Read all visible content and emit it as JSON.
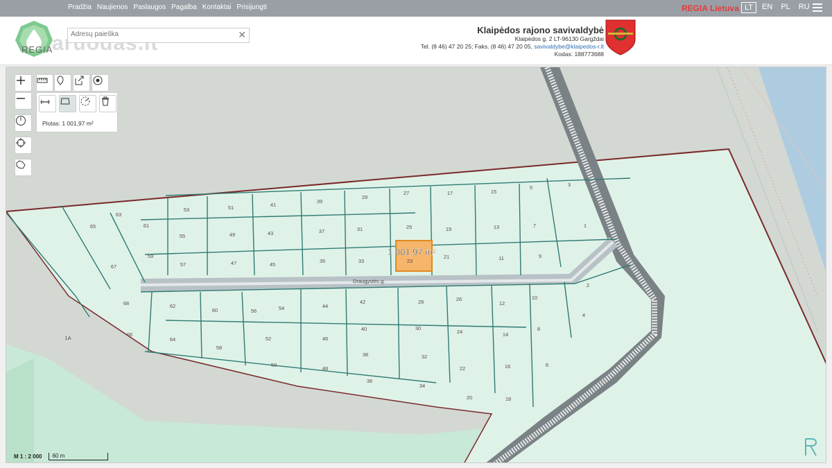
{
  "nav": {
    "items": [
      "Pradžia",
      "Naujienos",
      "Paslaugos",
      "Pagalba",
      "Kontaktai",
      "Prisijungti"
    ],
    "brand": "REGIA Lietuva",
    "langs": [
      "LT",
      "EN",
      "PL",
      "RU"
    ],
    "active_lang": "LT"
  },
  "header": {
    "logo_text": "REGIA",
    "watermark": "aruodas.lt",
    "search_placeholder": "Adresų paieška",
    "municipality": {
      "name": "Klaipėdos rajono savivaldybė",
      "address": "Klaipėdos g. 2 LT-96130 Gargždai",
      "phone": "Tel. (8 46) 47 20 25; Faks. (8 46) 47 20 05,",
      "email": "savivaldybe@klaipedos-r.lt",
      "code": "Kodas: 188773688"
    }
  },
  "map": {
    "street": "Draugystės g.",
    "measurement": "1 001,97 m²",
    "area_label": "Plotas: 1 001,97 m²",
    "scale_ratio": "M 1 : 2 000",
    "scale_distance": "60 m",
    "parcel_labels": {
      "north": [
        "53",
        "51",
        "41",
        "39",
        "29",
        "27",
        "17",
        "15",
        "5",
        "3"
      ],
      "row2": [
        "63",
        "61",
        "55",
        "49",
        "43",
        "37",
        "31",
        "25",
        "19",
        "13",
        "7",
        "1"
      ],
      "row3": [
        "65",
        "67",
        "59",
        "57",
        "47",
        "45",
        "35",
        "33",
        "23",
        "21",
        "11",
        "9"
      ],
      "south": [
        "68",
        "62",
        "60",
        "56",
        "54",
        "44",
        "42",
        "28",
        "26",
        "12",
        "10",
        "2",
        "4",
        "66",
        "64",
        "58",
        "52",
        "46",
        "40",
        "30",
        "24",
        "14",
        "8",
        "50",
        "48",
        "38",
        "32",
        "22",
        "16",
        "6",
        "36",
        "34",
        "20",
        "18",
        "1A"
      ]
    }
  },
  "colors": {
    "topbar": "#9a9fa6",
    "brand": "#e23b3b",
    "parcel_fill": "#dff2e8",
    "parcel_stroke": "#2f7a72",
    "boundary": "#7a2a2a",
    "selected": "#f5b56a"
  }
}
